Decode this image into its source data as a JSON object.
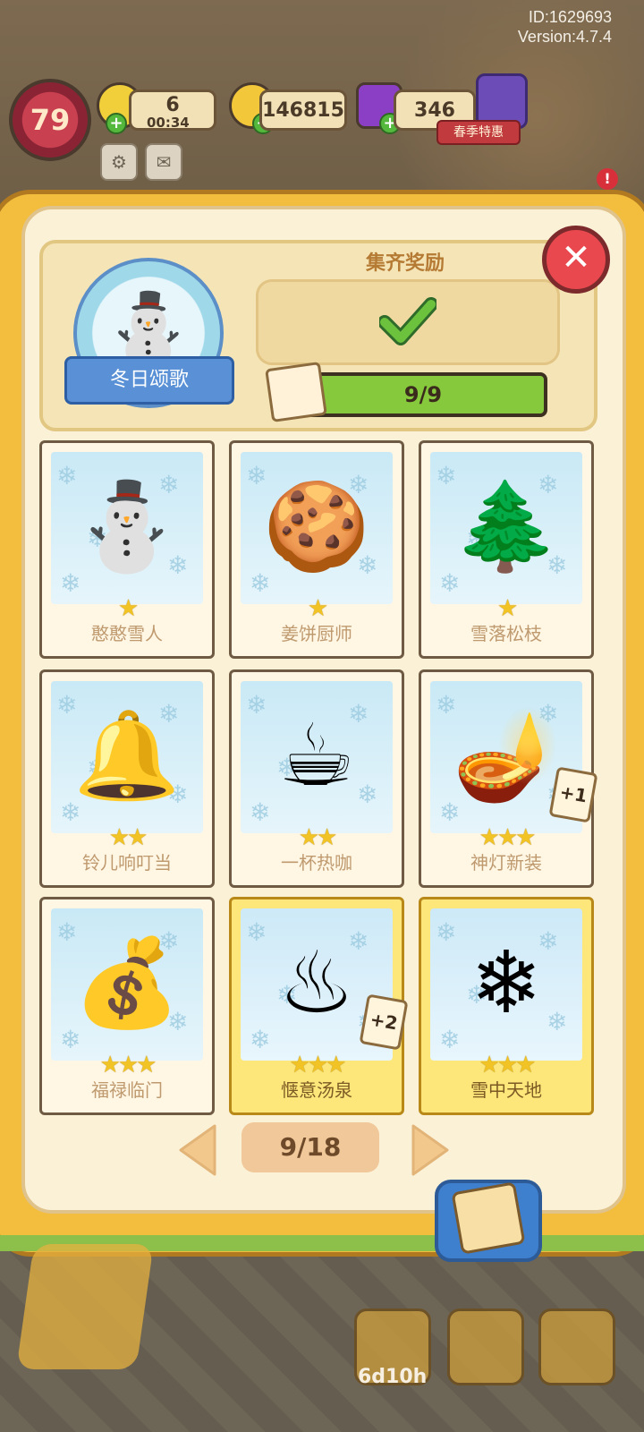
{
  "header": {
    "id_label": "ID:1629693",
    "version_label": "Version:4.7.4"
  },
  "hud": {
    "level": "79",
    "energy": "6",
    "energy_timer": "00:34",
    "coins": "146815",
    "gems": "346",
    "event_label": "春季特惠",
    "alert_badge": "!"
  },
  "collection": {
    "set_name": "冬日颂歌",
    "reward_title": "集齐奖励",
    "progress_text": "9/9",
    "progress_fraction": 1.0,
    "close_symbol": "✕"
  },
  "cards": [
    {
      "name": "憨憨雪人",
      "stars": "★",
      "emoji": "⛄",
      "gold": false,
      "badge": ""
    },
    {
      "name": "姜饼厨师",
      "stars": "★",
      "emoji": "🍪",
      "gold": false,
      "badge": ""
    },
    {
      "name": "雪落松枝",
      "stars": "★",
      "emoji": "🌲",
      "gold": false,
      "badge": ""
    },
    {
      "name": "铃儿响叮当",
      "stars": "★★",
      "emoji": "🔔",
      "gold": false,
      "badge": ""
    },
    {
      "name": "一杯热咖",
      "stars": "★★",
      "emoji": "☕",
      "gold": false,
      "badge": ""
    },
    {
      "name": "神灯新装",
      "stars": "★★★",
      "emoji": "🪔",
      "gold": false,
      "badge": "+1"
    },
    {
      "name": "福禄临门",
      "stars": "★★★",
      "emoji": "💰",
      "gold": false,
      "badge": ""
    },
    {
      "name": "惬意汤泉",
      "stars": "★★★",
      "emoji": "♨",
      "gold": true,
      "badge": "+2"
    },
    {
      "name": "雪中天地",
      "stars": "★★★",
      "emoji": "❄",
      "gold": true,
      "badge": ""
    }
  ],
  "pagination": {
    "page_text": "9/18"
  },
  "bottom": {
    "timer": "6d10h"
  },
  "icons": {
    "snowflake": "❄",
    "settings": "⚙",
    "mail": "✉"
  },
  "colors": {
    "book_gold": "#f3bd3e",
    "page_bg": "#fbf1d7",
    "progress_green": "#86c93c",
    "close_red": "#e9484f",
    "star_yellow": "#f1c324"
  }
}
